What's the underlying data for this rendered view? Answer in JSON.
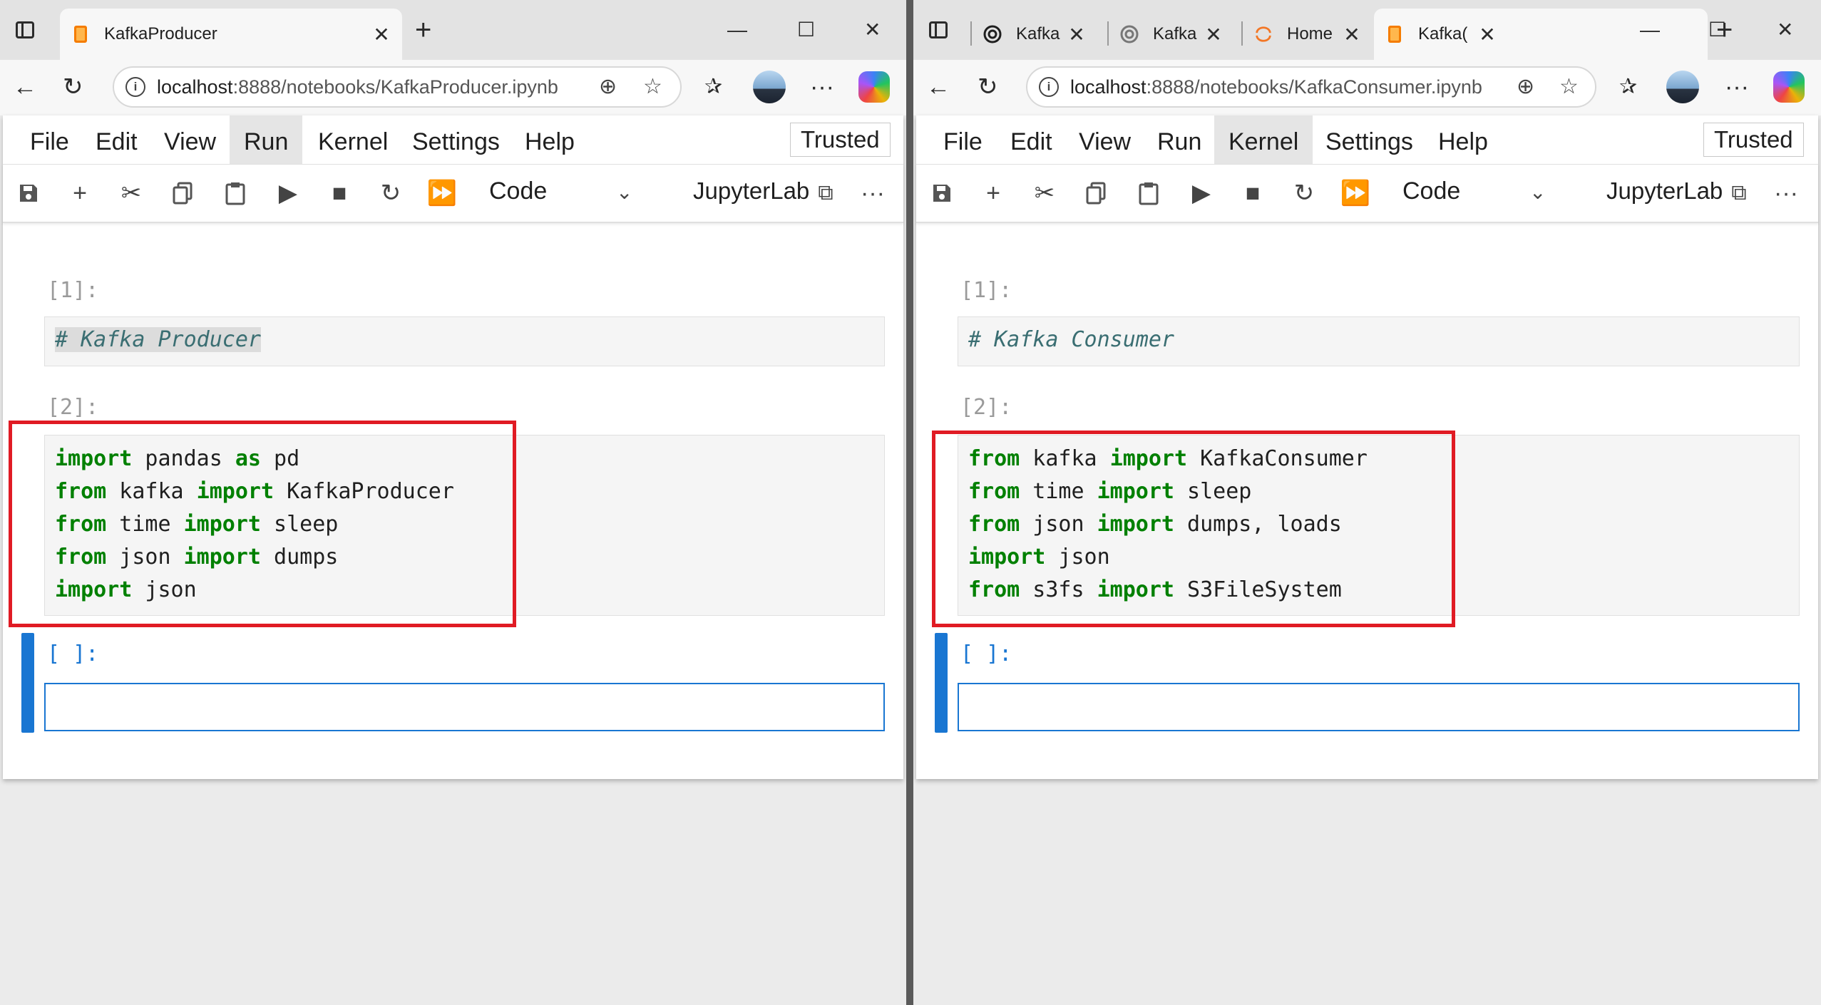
{
  "colors": {
    "accent": "#1976d2",
    "keyword": "#008000",
    "highlight_box": "#e01b24",
    "comment": "#3a6e72"
  },
  "windows": [
    {
      "tabs": [
        {
          "label": "KafkaProducer",
          "icon": "notebook-icon",
          "active": true
        }
      ],
      "url_host": "localhost",
      "url_path": ":8888/notebooks/KafkaProducer.ipynb",
      "menu": [
        "File",
        "Edit",
        "View",
        "Run",
        "Kernel",
        "Settings",
        "Help"
      ],
      "trusted": "Trusted",
      "cell_type": "Code",
      "jupyterlab": "JupyterLab",
      "cells": {
        "prompt1": "[1]:",
        "markdown": "# Kafka Producer",
        "prompt2": "[2]:",
        "code_lines": [
          [
            {
              "t": "import",
              "kw": true
            },
            {
              "t": " pandas "
            },
            {
              "t": "as",
              "kw": true
            },
            {
              "t": " pd"
            }
          ],
          [
            {
              "t": "from",
              "kw": true
            },
            {
              "t": " kafka "
            },
            {
              "t": "import",
              "kw": true
            },
            {
              "t": " KafkaProducer"
            }
          ],
          [
            {
              "t": "from",
              "kw": true
            },
            {
              "t": " time "
            },
            {
              "t": "import",
              "kw": true
            },
            {
              "t": " sleep"
            }
          ],
          [
            {
              "t": "from",
              "kw": true
            },
            {
              "t": " json "
            },
            {
              "t": "import",
              "kw": true
            },
            {
              "t": " dumps"
            }
          ],
          [
            {
              "t": "import",
              "kw": true
            },
            {
              "t": " json"
            }
          ]
        ],
        "prompt3": "[ ]:"
      }
    },
    {
      "tabs": [
        {
          "label": "Kafka",
          "icon": "openai-icon",
          "active": false
        },
        {
          "label": "Kafka",
          "icon": "openai-icon",
          "active": false
        },
        {
          "label": "Home",
          "icon": "jupyter-icon",
          "active": false
        },
        {
          "label": "Kafka(",
          "icon": "notebook-icon",
          "active": true
        }
      ],
      "url_host": "localhost",
      "url_path": ":8888/notebooks/KafkaConsumer.ipynb",
      "menu": [
        "File",
        "Edit",
        "View",
        "Run",
        "Kernel",
        "Settings",
        "Help"
      ],
      "trusted": "Trusted",
      "cell_type": "Code",
      "jupyterlab": "JupyterLab",
      "cells": {
        "prompt1": "[1]:",
        "markdown": "# Kafka Consumer",
        "prompt2": "[2]:",
        "code_lines": [
          [
            {
              "t": "from",
              "kw": true
            },
            {
              "t": " kafka "
            },
            {
              "t": "import",
              "kw": true
            },
            {
              "t": " KafkaConsumer"
            }
          ],
          [
            {
              "t": "from",
              "kw": true
            },
            {
              "t": " time "
            },
            {
              "t": "import",
              "kw": true
            },
            {
              "t": " sleep"
            }
          ],
          [
            {
              "t": "from",
              "kw": true
            },
            {
              "t": " json "
            },
            {
              "t": "import",
              "kw": true
            },
            {
              "t": " dumps, loads"
            }
          ],
          [
            {
              "t": "import",
              "kw": true
            },
            {
              "t": " json"
            }
          ],
          [
            {
              "t": "from",
              "kw": true
            },
            {
              "t": " s3fs "
            },
            {
              "t": "import",
              "kw": true
            },
            {
              "t": " S3FileSystem"
            }
          ]
        ],
        "prompt3": "[ ]:"
      }
    }
  ]
}
